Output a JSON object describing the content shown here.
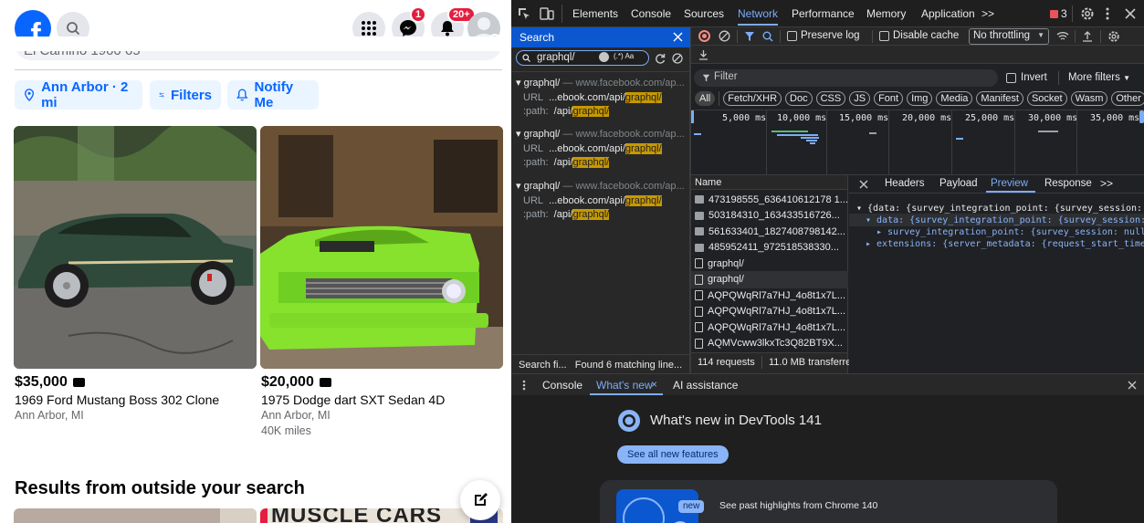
{
  "facebook": {
    "logo_letter": "f",
    "notif_badges": {
      "messenger": "1",
      "notifications": "20+"
    },
    "search_partial": "El Camino 1960 65",
    "chips": {
      "location": "Ann Arbor · 2 mi",
      "filters": "Filters",
      "notify": "Notify Me"
    },
    "listings": [
      {
        "price": "$35,000",
        "title": "1969 Ford Mustang Boss 302 Clone",
        "location": "Ann Arbor, MI",
        "extra": ""
      },
      {
        "price": "$20,000",
        "title": "1975 Dodge dart SXT Sedan 4D",
        "location": "Ann Arbor, MI",
        "extra": "40K miles"
      }
    ],
    "section_heading": "Results from outside your search",
    "banner_text": "MUSCLE CARS"
  },
  "devtools": {
    "tabs": [
      "Elements",
      "Console",
      "Sources",
      "Network",
      "Performance",
      "Memory",
      "Application"
    ],
    "active_tab": "Network",
    "more_tabs": ">>",
    "issues_count": "3",
    "search_label": "Search",
    "search_query": "graphql/",
    "search_opts": "(.*)  Aa",
    "results": [
      {
        "name": "graphql/",
        "host": "www.facebook.com/ap...",
        "url_label": "URL",
        "url_prefix": "...ebook.com/api/",
        "url_match": "graphql/",
        "path_label": ":path:",
        "path_prefix": "/api/",
        "path_match": "graphql/"
      },
      {
        "name": "graphql/",
        "host": "www.facebook.com/ap...",
        "url_label": "URL",
        "url_prefix": "...ebook.com/api/",
        "url_match": "graphql/",
        "path_label": ":path:",
        "path_prefix": "/api/",
        "path_match": "graphql/"
      },
      {
        "name": "graphql/",
        "host": "www.facebook.com/ap...",
        "url_label": "URL",
        "url_prefix": "...ebook.com/api/",
        "url_match": "graphql/",
        "path_label": ":path:",
        "path_prefix": "/api/",
        "path_match": "graphql/"
      }
    ],
    "search_status": {
      "label": "Search fi...",
      "found": "Found 6 matching line..."
    },
    "toolbar": {
      "preserve_log": "Preserve log",
      "disable_cache": "Disable cache",
      "throttling": "No throttling"
    },
    "filter": {
      "placeholder": "Filter",
      "invert": "Invert",
      "more_filters": "More filters"
    },
    "type_filters": [
      "All",
      "Fetch/XHR",
      "Doc",
      "CSS",
      "JS",
      "Font",
      "Img",
      "Media",
      "Manifest",
      "Socket",
      "Wasm",
      "Other"
    ],
    "timeline_ticks": [
      "5,000 ms",
      "10,000 ms",
      "15,000 ms",
      "20,000 ms",
      "25,000 ms",
      "30,000 ms",
      "35,000 ms"
    ],
    "name_header": "Name",
    "requests": [
      {
        "name": "473198555_636410612178 1...",
        "type": "img"
      },
      {
        "name": "503184310_163433516726...",
        "type": "img"
      },
      {
        "name": "561633401_1827408798142...",
        "type": "img"
      },
      {
        "name": "485952411_972518538330...",
        "type": "img"
      },
      {
        "name": "graphql/",
        "type": "doc"
      },
      {
        "name": "graphql/",
        "type": "doc"
      },
      {
        "name": "AQPQWqRl7a7HJ_4o8t1x7L...",
        "type": "doc"
      },
      {
        "name": "AQPQWqRl7a7HJ_4o8t1x7L...",
        "type": "doc"
      },
      {
        "name": "AQPQWqRl7a7HJ_4o8t1x7L...",
        "type": "doc"
      },
      {
        "name": "AQMVcww3lkxTc3Q82BT9X...",
        "type": "doc"
      }
    ],
    "status_bar": {
      "requests": "114 requests",
      "transferred": "11.0 MB transferre"
    },
    "detail_tabs": [
      "Headers",
      "Payload",
      "Preview",
      "Response"
    ],
    "active_detail_tab": "Preview",
    "preview_lines": [
      "▾ {data: {survey_integration_point: {survey_session: nu",
      "▾ data: {survey_integration_point: {survey_session: n",
      "▸ survey_integration_point: {survey_session: null,",
      "▸ extensions: {server_metadata: {request_start_time_m"
    ],
    "drawer": {
      "tabs": [
        "Console",
        "What's new",
        "AI assistance"
      ],
      "active": "What's new",
      "heading": "What's new in DevTools 141",
      "button": "See all new features",
      "card_badge": "new",
      "card_text": "See past highlights from Chrome 140"
    }
  },
  "colors": {
    "fb_blue": "#0866ff",
    "chip_bg": "#ebf5ff",
    "dt_bg": "#202124",
    "dt_accent": "#7cacf8",
    "highlight": "#c79800"
  }
}
